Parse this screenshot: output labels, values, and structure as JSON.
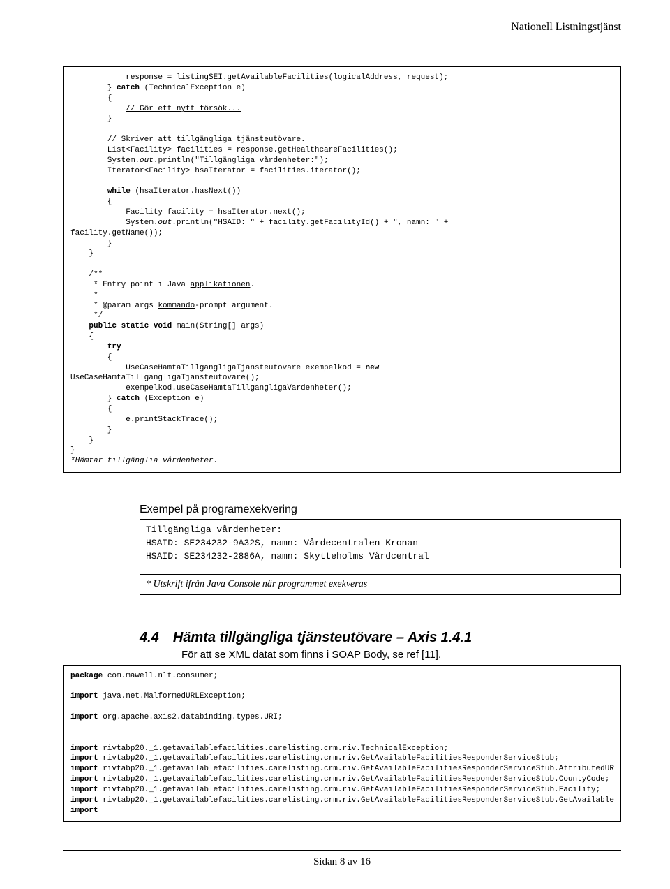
{
  "header_title": "Nationell Listningstjänst",
  "code1": {
    "l01": "            response = listingSEI.getAvailableFacilities(logicalAddress, request);",
    "l02a": "        } ",
    "l02b": "catch",
    "l02c": " (TechnicalException e)",
    "l03": "        {",
    "l04a": "            ",
    "l04b": "// Gör ett nytt försök...",
    "l05": "        }",
    "blank1": "",
    "l06a": "        ",
    "l06b": "// Skriver att tillgängliga tjänsteutövare.",
    "l07": "        List<Facility> facilities = response.getHealthcareFacilities();",
    "l08a": "        System.",
    "l08b": "out",
    "l08c": ".println(\"Tillgängliga vårdenheter:\");",
    "l09": "        Iterator<Facility> hsaIterator = facilities.iterator();",
    "blank2": "",
    "l10a": "        ",
    "l10b": "while",
    "l10c": " (hsaIterator.hasNext())",
    "l11": "        {",
    "l12": "            Facility facility = hsaIterator.next();",
    "l13a": "            System.",
    "l13b": "out",
    "l13c": ".println(\"HSAID: \" + facility.getFacilityId() + \", namn: \" +",
    "l14": "facility.getName());",
    "l15": "        }",
    "l16": "    }",
    "blank3": "",
    "c1": "    /**",
    "c2a": "     * Entry point i Java ",
    "c2b": "applikationen",
    "c2c": ".",
    "c3": "     *",
    "c4a": "     * @param args ",
    "c4b": "kommando",
    "c4c": "-prompt argument.",
    "c5": "     */",
    "m1a": "    ",
    "m1b": "public static void",
    "m1c": " main(String[] args)",
    "m2": "    {",
    "m3a": "        ",
    "m3b": "try",
    "m4": "        {",
    "m5a": "            UseCaseHamtaTillgangligaTjansteutovare exempelkod = ",
    "m5b": "new",
    "m6": "UseCaseHamtaTillgangligaTjansteutovare();",
    "m7": "            exempelkod.useCaseHamtaTillgangligaVardenheter();",
    "m8a": "        } ",
    "m8b": "catch",
    "m8c": " (Exception e)",
    "m9": "        {",
    "m10": "            e.printStackTrace();",
    "m11": "        }",
    "m12": "    }",
    "m13": "}",
    "footer": "*Hämtar tillgänglia vårdenheter."
  },
  "exempel_title": "Exempel på programexekvering",
  "exempel_output": {
    "l1": "Tillgängliga vårdenheter:",
    "l2": "HSAID: SE234232-9A32S, namn: Vårdecentralen Kronan",
    "l3": "HSAID: SE234232-2886A, namn: Skytteholms Vårdcentral"
  },
  "exempel_note": "* Utskrift ifrån Java Console när programmet exekveras",
  "heading_num": "4.4",
  "heading_txt": "Hämta tillgängliga tjänsteutövare – Axis 1.4.1",
  "heading_sub": "För att se XML datat som finns i SOAP Body, se ref [11].",
  "code2": {
    "p1a": "package",
    "p1b": " com.mawell.nlt.consumer;",
    "blank1": "",
    "i1a": "import",
    "i1b": " java.net.MalformedURLException;",
    "blank2": "",
    "i2a": "import",
    "i2b": " org.apache.axis2.databinding.types.URI;",
    "blank3": "",
    "blank3b": "",
    "i3a": "import",
    "i3b": " rivtabp20._1.getavailablefacilities.carelisting.crm.riv.TechnicalException;",
    "i4a": "import",
    "i4b": " rivtabp20._1.getavailablefacilities.carelisting.crm.riv.GetAvailableFacilitiesResponderServiceStub;",
    "i5a": "import",
    "i5b": " rivtabp20._1.getavailablefacilities.carelisting.crm.riv.GetAvailableFacilitiesResponderServiceStub.AttributedUR",
    "i6a": "import",
    "i6b": " rivtabp20._1.getavailablefacilities.carelisting.crm.riv.GetAvailableFacilitiesResponderServiceStub.CountyCode;",
    "i7a": "import",
    "i7b": " rivtabp20._1.getavailablefacilities.carelisting.crm.riv.GetAvailableFacilitiesResponderServiceStub.Facility;",
    "i8a": "import",
    "i8b": " rivtabp20._1.getavailablefacilities.carelisting.crm.riv.GetAvailableFacilitiesResponderServiceStub.GetAvailable",
    "i9": "import"
  },
  "footer": "Sidan 8 av 16"
}
